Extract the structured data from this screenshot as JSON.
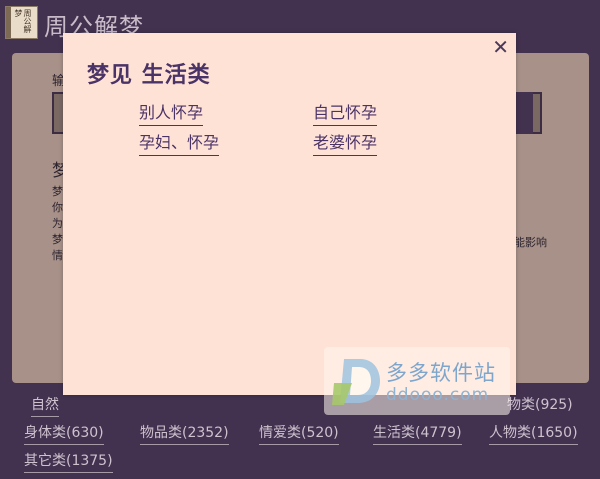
{
  "header": {
    "logo_text": "周公解梦",
    "title": "周公解梦"
  },
  "background": {
    "input_label": "输",
    "result_title": "梦",
    "result_text_chars": [
      "梦",
      "你",
      "为",
      "梦",
      "情"
    ],
    "result_text_right": "能影响"
  },
  "categories": [
    {
      "label": "自然"
    },
    {
      "label": "物类(925)"
    },
    {
      "label": "身体类(630)"
    },
    {
      "label": "物品类(2352)"
    },
    {
      "label": "情爱类(520)"
    },
    {
      "label": "生活类(4779)"
    },
    {
      "label": "人物类(1650)"
    },
    {
      "label": "其它类(1375)"
    }
  ],
  "modal": {
    "title": "梦见  生活类",
    "close_symbol": "✕",
    "links": [
      {
        "label": "别人怀孕"
      },
      {
        "label": "自己怀孕"
      },
      {
        "label": "孕妇、怀孕"
      },
      {
        "label": "老婆怀孕"
      }
    ]
  },
  "watermark": {
    "cn": "多多软件站",
    "en": "ddooo.com"
  },
  "colors": {
    "page_bg": "#42314f",
    "panel_bg": "#a79188",
    "modal_bg": "#ffe2d6",
    "modal_text": "#4a3366"
  }
}
